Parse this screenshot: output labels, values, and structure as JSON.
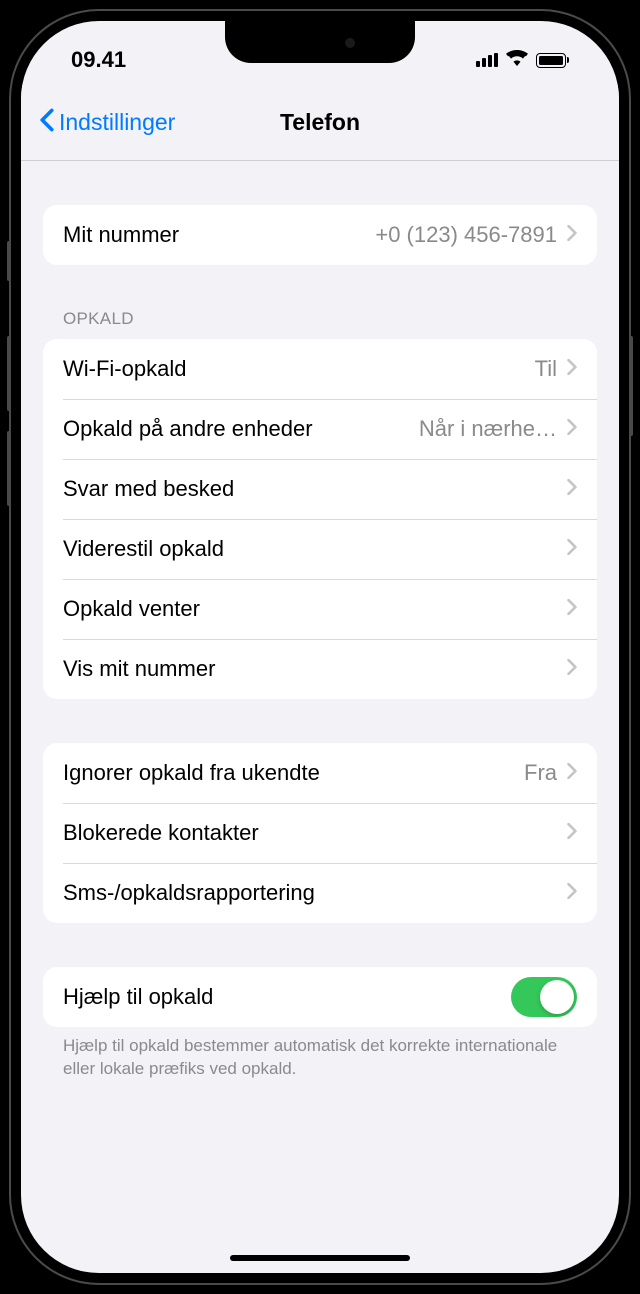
{
  "status": {
    "time": "09.41"
  },
  "nav": {
    "back_label": "Indstillinger",
    "title": "Telefon"
  },
  "my_number": {
    "label": "Mit nummer",
    "value": "+0 (123) 456-7891"
  },
  "calls_section": {
    "header": "OPKALD",
    "rows": [
      {
        "label": "Wi-Fi-opkald",
        "value": "Til"
      },
      {
        "label": "Opkald på andre enheder",
        "value": "Når i nærhe…"
      },
      {
        "label": "Svar med besked",
        "value": ""
      },
      {
        "label": "Viderestil opkald",
        "value": ""
      },
      {
        "label": "Opkald venter",
        "value": ""
      },
      {
        "label": "Vis mit nummer",
        "value": ""
      }
    ]
  },
  "block_section": {
    "rows": [
      {
        "label": "Ignorer opkald fra ukendte",
        "value": "Fra"
      },
      {
        "label": "Blokerede kontakter",
        "value": ""
      },
      {
        "label": "Sms-/opkaldsrapportering",
        "value": ""
      }
    ]
  },
  "dial_assist": {
    "label": "Hjælp til opkald",
    "enabled": true,
    "footer": "Hjælp til opkald bestemmer automatisk det korrekte internationale eller lokale præfiks ved opkald."
  }
}
